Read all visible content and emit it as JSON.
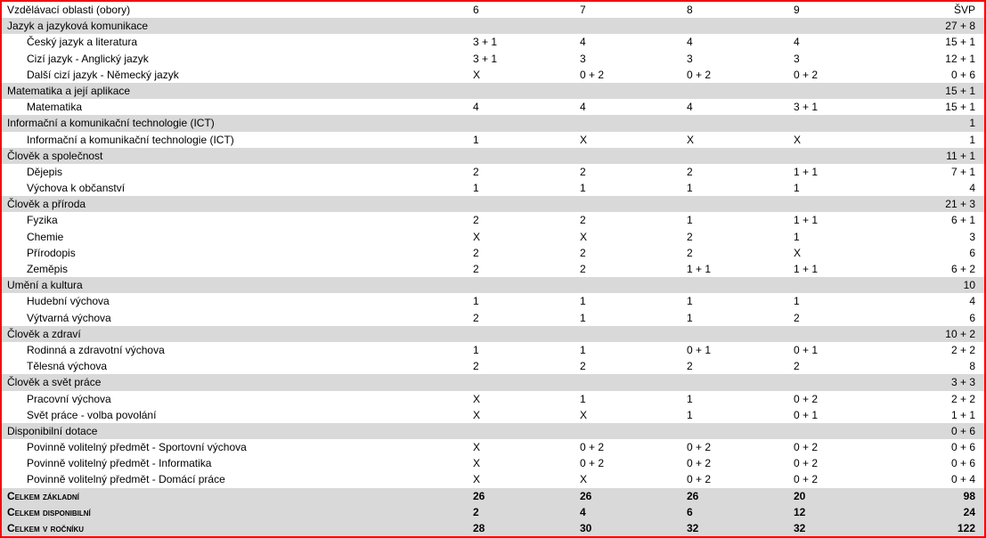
{
  "header": {
    "label": "Vzdělávací oblasti (obory)",
    "cols": [
      "6",
      "7",
      "8",
      "9"
    ],
    "svp": "ŠVP"
  },
  "rows": [
    {
      "type": "section",
      "label": "Jazyk a jazyková komunikace",
      "c": [
        "",
        "",
        "",
        ""
      ],
      "s": "27 + 8"
    },
    {
      "type": "item",
      "label": "Český jazyk a literatura",
      "c": [
        "3 + 1",
        "4",
        "4",
        "4"
      ],
      "s": "15 + 1"
    },
    {
      "type": "item",
      "label": "Cizí jazyk - Anglický jazyk",
      "c": [
        "3 + 1",
        "3",
        "3",
        "3"
      ],
      "s": "12 + 1"
    },
    {
      "type": "item",
      "label": "Další cizí jazyk - Německý jazyk",
      "c": [
        "X",
        "0 + 2",
        "0 + 2",
        "0 + 2"
      ],
      "s": "0 + 6"
    },
    {
      "type": "section",
      "label": "Matematika a její aplikace",
      "c": [
        "",
        "",
        "",
        ""
      ],
      "s": "15 + 1"
    },
    {
      "type": "item",
      "label": "Matematika",
      "c": [
        "4",
        "4",
        "4",
        "3 + 1"
      ],
      "s": "15 + 1"
    },
    {
      "type": "section",
      "label": "Informační a komunikační technologie (ICT)",
      "c": [
        "",
        "",
        "",
        ""
      ],
      "s": "1"
    },
    {
      "type": "item",
      "label": "Informační a komunikační technologie (ICT)",
      "c": [
        "1",
        "X",
        "X",
        "X"
      ],
      "s": "1"
    },
    {
      "type": "section",
      "label": "Člověk a společnost",
      "c": [
        "",
        "",
        "",
        ""
      ],
      "s": "11 + 1"
    },
    {
      "type": "item",
      "label": "Dějepis",
      "c": [
        "2",
        "2",
        "2",
        "1 + 1"
      ],
      "s": "7 + 1"
    },
    {
      "type": "item",
      "label": "Výchova k občanství",
      "c": [
        "1",
        "1",
        "1",
        "1"
      ],
      "s": "4"
    },
    {
      "type": "section",
      "label": "Člověk a příroda",
      "c": [
        "",
        "",
        "",
        ""
      ],
      "s": "21 + 3"
    },
    {
      "type": "item",
      "label": "Fyzika",
      "c": [
        "2",
        "2",
        "1",
        "1 + 1"
      ],
      "s": "6 + 1"
    },
    {
      "type": "item",
      "label": "Chemie",
      "c": [
        "X",
        "X",
        "2",
        "1"
      ],
      "s": "3"
    },
    {
      "type": "item",
      "label": "Přírodopis",
      "c": [
        "2",
        "2",
        "2",
        "X"
      ],
      "s": "6"
    },
    {
      "type": "item",
      "label": "Zeměpis",
      "c": [
        "2",
        "2",
        "1 + 1",
        "1 + 1"
      ],
      "s": "6 + 2"
    },
    {
      "type": "section",
      "label": "Umění a kultura",
      "c": [
        "",
        "",
        "",
        ""
      ],
      "s": "10"
    },
    {
      "type": "item",
      "label": "Hudební výchova",
      "c": [
        "1",
        "1",
        "1",
        "1"
      ],
      "s": "4"
    },
    {
      "type": "item",
      "label": "Výtvarná výchova",
      "c": [
        "2",
        "1",
        "1",
        "2"
      ],
      "s": "6"
    },
    {
      "type": "section",
      "label": "Člověk a zdraví",
      "c": [
        "",
        "",
        "",
        ""
      ],
      "s": "10 + 2"
    },
    {
      "type": "item",
      "label": "Rodinná a zdravotní výchova",
      "c": [
        "1",
        "1",
        "0 + 1",
        "0 + 1"
      ],
      "s": "2 + 2"
    },
    {
      "type": "item",
      "label": "Tělesná výchova",
      "c": [
        "2",
        "2",
        "2",
        "2"
      ],
      "s": "8"
    },
    {
      "type": "section",
      "label": "Člověk a svět práce",
      "c": [
        "",
        "",
        "",
        ""
      ],
      "s": "3 + 3"
    },
    {
      "type": "item",
      "label": "Pracovní výchova",
      "c": [
        "X",
        "1",
        "1",
        "0 + 2"
      ],
      "s": "2 + 2"
    },
    {
      "type": "item",
      "label": "Svět práce - volba povolání",
      "c": [
        "X",
        "X",
        "1",
        "0 + 1"
      ],
      "s": "1 + 1"
    },
    {
      "type": "section",
      "label": "Disponibilní dotace",
      "c": [
        "",
        "",
        "",
        ""
      ],
      "s": "0 + 6"
    },
    {
      "type": "item",
      "label": "Povinně volitelný předmět - Sportovní výchova",
      "c": [
        "X",
        "0 + 2",
        "0 + 2",
        "0 + 2"
      ],
      "s": "0 + 6"
    },
    {
      "type": "item",
      "label": "Povinně volitelný předmět - Informatika",
      "c": [
        "X",
        "0 + 2",
        "0 + 2",
        "0 + 2"
      ],
      "s": "0 + 6"
    },
    {
      "type": "item",
      "label": "Povinně volitelný předmět - Domácí práce",
      "c": [
        "X",
        "X",
        "0 + 2",
        "0 + 2"
      ],
      "s": "0 + 4"
    },
    {
      "type": "summary",
      "label": "Celkem základní",
      "c": [
        "26",
        "26",
        "26",
        "20"
      ],
      "s": "98"
    },
    {
      "type": "summary",
      "label": "Celkem disponibilní",
      "c": [
        "2",
        "4",
        "6",
        "12"
      ],
      "s": "24"
    },
    {
      "type": "summary",
      "label": "Celkem v ročníku",
      "c": [
        "28",
        "30",
        "32",
        "32"
      ],
      "s": "122"
    }
  ]
}
